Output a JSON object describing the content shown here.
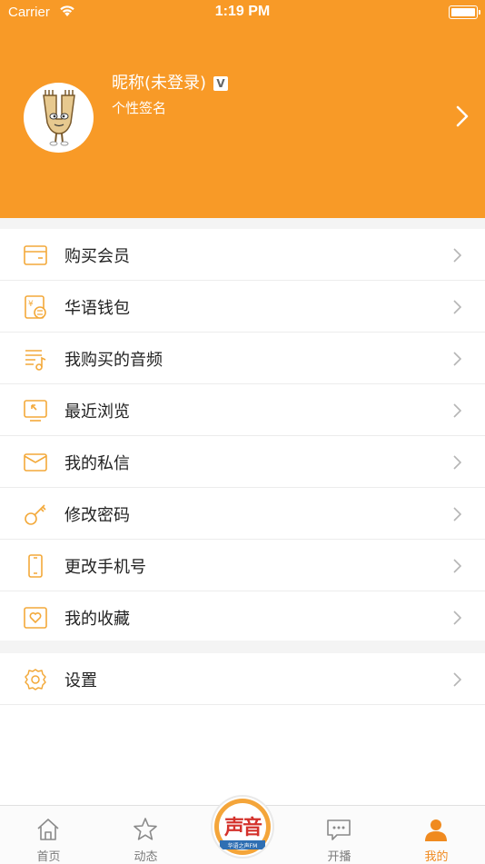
{
  "status_bar": {
    "carrier": "Carrier",
    "time": "1:19 PM"
  },
  "profile": {
    "nickname": "昵称(未登录)",
    "badge": "V",
    "signature": "个性签名",
    "header_color": "#f89a27"
  },
  "menu": {
    "items": [
      {
        "label": "购买会员",
        "icon": "member-card-icon"
      },
      {
        "label": "华语钱包",
        "icon": "wallet-icon"
      },
      {
        "label": "我购买的音频",
        "icon": "music-list-icon"
      },
      {
        "label": "最近浏览",
        "icon": "recent-icon"
      },
      {
        "label": "我的私信",
        "icon": "message-icon"
      },
      {
        "label": "修改密码",
        "icon": "key-icon"
      },
      {
        "label": "更改手机号",
        "icon": "phone-icon"
      },
      {
        "label": "我的收藏",
        "icon": "favorite-icon"
      }
    ],
    "settings_label": "设置"
  },
  "tabbar": {
    "tabs": [
      {
        "label": "首页",
        "icon": "home-icon"
      },
      {
        "label": "动态",
        "icon": "star-icon"
      },
      {
        "label": "开播",
        "icon": "chat-icon"
      },
      {
        "label": "我的",
        "icon": "person-icon",
        "active": true
      }
    ],
    "center_logo_text": "声音",
    "center_logo_subtext": "华语之声FM",
    "active_color": "#f08a1f"
  }
}
